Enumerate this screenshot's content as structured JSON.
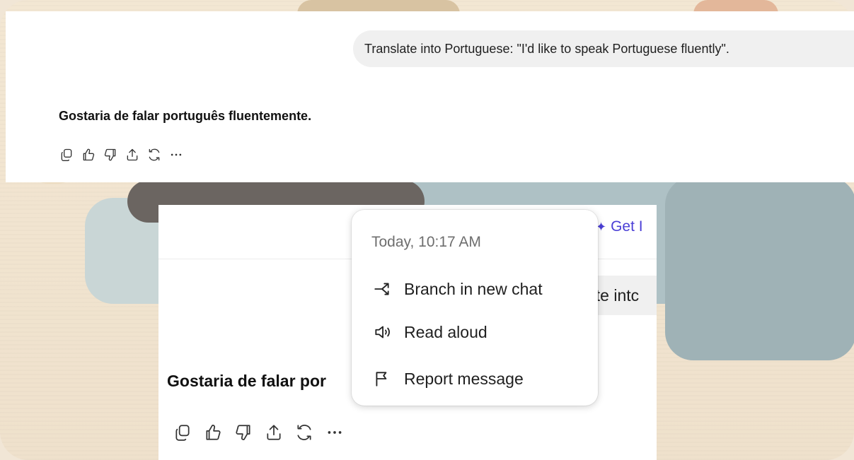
{
  "conversation": {
    "user_message": "Translate into Portuguese: \"I'd like to speak Portuguese fluently\".",
    "assistant_message": "Gostaria de falar português fluentemente."
  },
  "zoomed_view": {
    "header_link": "Get I",
    "user_message_partial": "ate intc",
    "assistant_message_partial": "Gostaria de falar por"
  },
  "message_actions": [
    {
      "icon": "copy-icon"
    },
    {
      "icon": "thumbs-up-icon"
    },
    {
      "icon": "thumbs-down-icon"
    },
    {
      "icon": "share-icon"
    },
    {
      "icon": "regenerate-icon"
    },
    {
      "icon": "more-icon"
    }
  ],
  "context_menu": {
    "timestamp": "Today, 10:17 AM",
    "items": [
      {
        "label": "Branch in new chat",
        "icon": "branch-icon"
      },
      {
        "label": "Read aloud",
        "icon": "speaker-icon"
      },
      {
        "label": "Report message",
        "icon": "flag-icon"
      }
    ]
  },
  "colors": {
    "accent": "#4b3fd6",
    "bubble": "#f0f0f0",
    "background": "#f1e6d6"
  }
}
